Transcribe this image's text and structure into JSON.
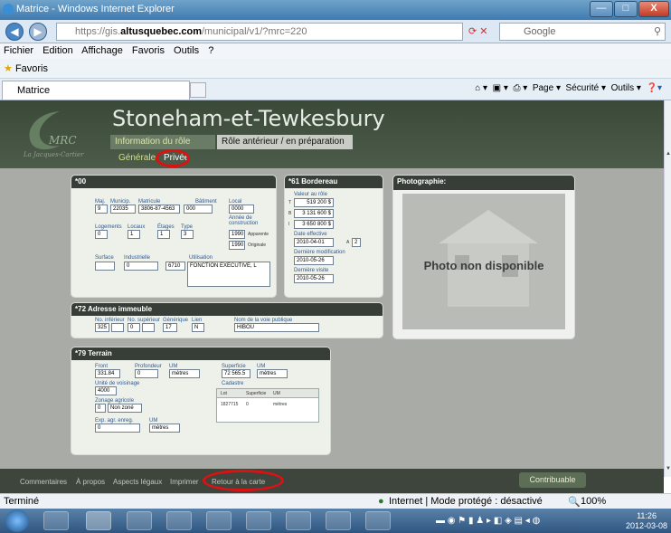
{
  "window": {
    "title": "Matrice - Windows Internet Explorer",
    "minimize": "—",
    "maximize": "□",
    "close": "X"
  },
  "browser": {
    "url_host": "https://gis.",
    "url_domain": "altusquebec.com",
    "url_path": "/municipal/v1/?mrc=220",
    "search_placeholder": "Google",
    "menu": [
      "Fichier",
      "Edition",
      "Affichage",
      "Favoris",
      "Outils",
      "?"
    ],
    "favorites_label": "Favoris",
    "tab_title": "Matrice",
    "commands": [
      "Page ▾",
      "Sécurité ▾",
      "Outils ▾"
    ]
  },
  "app": {
    "logo_text": "MRC",
    "logo_sub": "La Jacques-Cartier",
    "city": "Stoneham-et-Tewkesbury",
    "tabs": [
      "Information du rôle",
      "Rôle antérieur / en préparation"
    ],
    "subtabs": [
      "Générale",
      "Privée"
    ]
  },
  "panel00": {
    "title": "*00",
    "maj_label": "Maj.",
    "maj": "9",
    "munic_label": "Municip.",
    "munic": "22035",
    "matricule_label": "Matricule",
    "matricule": "3806-87-4563",
    "batiment_label": "Bâtiment",
    "batiment": "000",
    "local_label": "Local",
    "local": "0000",
    "logements_label": "Logements",
    "logements": "0",
    "locaux_label": "Locaux",
    "locaux": "1",
    "etages_label": "Étages",
    "etages": "1",
    "type_label": "Type",
    "type": "3",
    "annee_label": "Année de construction",
    "annee_apparente": "1990",
    "apparente_label": "Apparente",
    "annee_originale": "1990",
    "originale_label": "Originale",
    "surface_label": "Surface",
    "surface": "",
    "industrielle_label": "Industrielle",
    "industrielle": "0",
    "utilisation_label": "Utilisation",
    "utilisation_code": "6710",
    "utilisation_desc": "FONCTION EXÉCUTIVE, L"
  },
  "panel61": {
    "title": "*61 Bordereau",
    "valeur_label": "Valeur au rôle",
    "rows": [
      {
        "k": "T",
        "v": "519 200 $"
      },
      {
        "k": "B",
        "v": "3 131 600 $"
      },
      {
        "k": "I",
        "v": "3 650 800 $"
      }
    ],
    "date_effective_label": "Date effective",
    "date_effective": "2010-04-01",
    "a_label": "A",
    "a_value": "2",
    "derniere_modif_label": "Dernière modification",
    "derniere_modif": "2010-05-26",
    "derniere_visite_label": "Dernière visite",
    "derniere_visite": "2010-05-26"
  },
  "photo": {
    "title": "Photographie:",
    "placeholder": "Photo non disponible"
  },
  "panel72": {
    "title": "*72 Adresse immeuble",
    "no_inf_label": "No. inférieur",
    "no_inf": "325",
    "no_sup_label": "No. supérieur",
    "no_sup": "0",
    "generique_label": "Générique",
    "generique": "17",
    "lien_label": "Lien",
    "lien": "N",
    "voie_label": "Nom de la voie publique",
    "voie": "HIBOU"
  },
  "panel79": {
    "title": "*79 Terrain",
    "front_label": "Front",
    "front": "331.84",
    "profondeur_label": "Profondeur",
    "profondeur": "0",
    "um_label": "UM",
    "um": "mètres",
    "superficie_label": "Superficie",
    "superficie": "72 565.5",
    "um2_label": "UM",
    "um2": "mètres",
    "voisinage_label": "Unité de voisinage",
    "voisinage": "4000",
    "zonage_label": "Zonage agricole",
    "zonage_code": "0",
    "zonage": "Non zoné",
    "exp_label": "Exp. agr. enreg.",
    "exp": "0",
    "exp_um_label": "UM",
    "exp_um": "mètres",
    "cadastre_label": "Cadastre",
    "cadastre_headers": [
      "Lot",
      "Superficie",
      "UM"
    ],
    "cadastre_rows": [
      {
        "lot": "1827715",
        "superficie": "0",
        "um": "mètres"
      }
    ]
  },
  "footer": {
    "links": [
      "Commentaires",
      "À propos",
      "Aspects légaux",
      "Imprimer",
      "Retour à la carte"
    ],
    "button": "Contribuable"
  },
  "status": {
    "left": "Terminé",
    "zone": "Internet | Mode protégé : désactivé",
    "zoom": "100%"
  },
  "taskbar": {
    "time": "11:26",
    "date": "2012-03-08"
  },
  "colors": {
    "highlight_ring": "#d11111",
    "header": "#3a4938",
    "label_blue": "#2e5b94"
  }
}
